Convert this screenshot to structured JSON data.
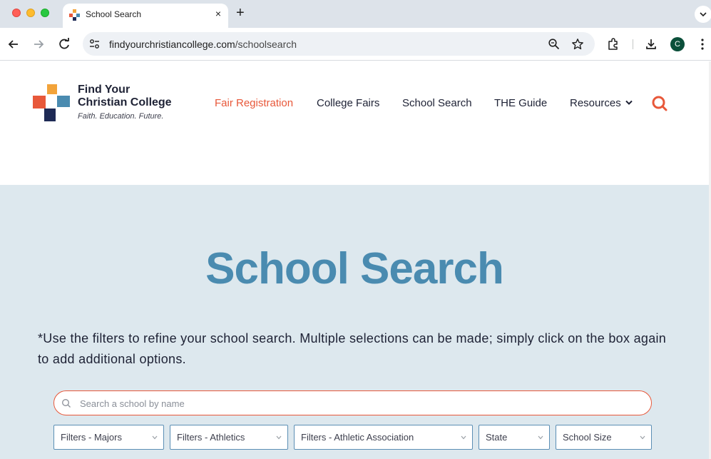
{
  "browser": {
    "tab_title": "School Search",
    "tab_close": "×",
    "new_tab": "+",
    "url_domain": "findyourchristiancollege.com",
    "url_path": "/schoolsearch",
    "profile_initial": "C"
  },
  "site": {
    "logo_line1": "Find Your",
    "logo_line2": "Christian College",
    "tagline": "Faith. Education. Future.",
    "nav": [
      {
        "label": "Fair Registration"
      },
      {
        "label": "College Fairs"
      },
      {
        "label": "School Search"
      },
      {
        "label": "THE Guide"
      },
      {
        "label": "Resources"
      }
    ],
    "accent_color": "#e8583a",
    "brand_blue": "#4a8bb0"
  },
  "hero": {
    "title": "School Search",
    "note": "*Use the filters to refine your school search. Multiple selections can be made; simply click on the box again to add additional options.",
    "search_placeholder": "Search a school by name",
    "filters": [
      {
        "label": "Filters - Majors"
      },
      {
        "label": "Filters - Athletics"
      },
      {
        "label": "Filters - Athletic Association"
      },
      {
        "label": "State"
      },
      {
        "label": "School Size"
      }
    ]
  }
}
